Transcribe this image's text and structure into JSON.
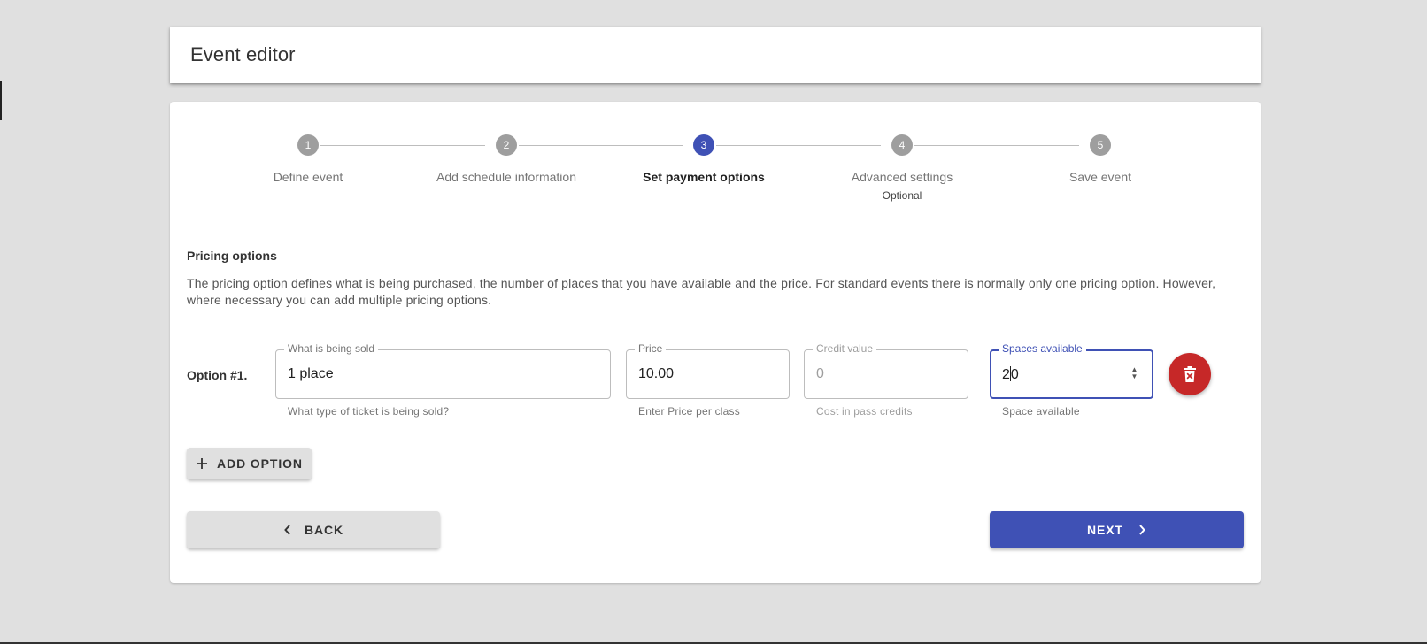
{
  "header": {
    "title": "Event editor"
  },
  "stepper": {
    "steps": [
      {
        "number": "1",
        "label": "Define event"
      },
      {
        "number": "2",
        "label": "Add schedule information"
      },
      {
        "number": "3",
        "label": "Set payment options",
        "active": true
      },
      {
        "number": "4",
        "label": "Advanced settings",
        "sublabel": "Optional"
      },
      {
        "number": "5",
        "label": "Save event"
      }
    ]
  },
  "pricing": {
    "title": "Pricing options",
    "description": "The pricing option defines what is being purchased, the number of places that you have available and the price. For standard events there is normally only one pricing option. However, where necessary you can add multiple pricing options.",
    "option_label": "Option #1.",
    "fields": {
      "what_sold": {
        "label": "What is being sold",
        "value": "1 place",
        "helper": "What type of ticket is being sold?"
      },
      "price": {
        "label": "Price",
        "value": "10.00",
        "helper": "Enter Price per class"
      },
      "credit": {
        "label": "Credit value",
        "value": "0",
        "helper": "Cost in pass credits"
      },
      "spaces": {
        "label": "Spaces available",
        "value_before_caret": "2",
        "value_after_caret": "0",
        "helper": "Space available"
      }
    }
  },
  "buttons": {
    "add_option": "ADD OPTION",
    "back": "BACK",
    "next": "NEXT"
  },
  "colors": {
    "primary": "#3f51b5",
    "danger": "#c62828",
    "inactive_step": "#9e9e9e"
  },
  "icons": {
    "add": "plus-icon",
    "back": "chevron-left-icon",
    "next": "chevron-right-icon",
    "delete": "delete-icon"
  }
}
